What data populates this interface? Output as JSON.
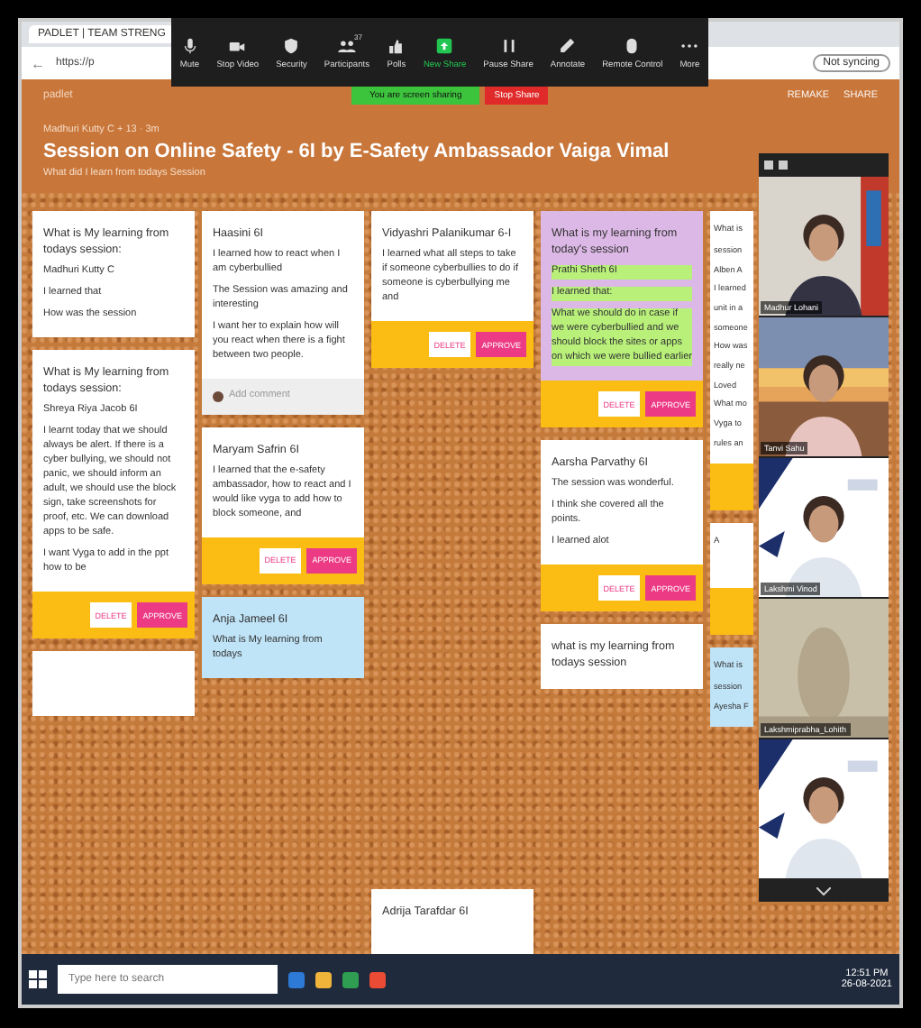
{
  "browser": {
    "tab_title": "PADLET | TEAM STRENG",
    "back": "←",
    "address": "https://p",
    "profile": "Not syncing"
  },
  "zoom_toolbar": {
    "buttons": [
      {
        "kind": "mic",
        "label": "Mute"
      },
      {
        "kind": "camera",
        "label": "Stop Video"
      },
      {
        "kind": "shield",
        "label": "Security"
      },
      {
        "kind": "people",
        "label": "Participants",
        "badge": "37"
      },
      {
        "kind": "polls",
        "label": "Polls"
      },
      {
        "kind": "share",
        "label": "New Share"
      },
      {
        "kind": "pause",
        "label": "Pause Share"
      },
      {
        "kind": "pen",
        "label": "Annotate"
      },
      {
        "kind": "mouse",
        "label": "Remote Control"
      },
      {
        "kind": "more",
        "label": "More"
      }
    ]
  },
  "share_banner": {
    "status": "You are screen sharing",
    "stop": "Stop Share"
  },
  "padlet": {
    "logo": "padlet",
    "actions": [
      "REMAKE",
      "SHARE"
    ],
    "author": "Madhuri Kutty C + 13 · 3m",
    "title": "Session on Online Safety - 6I by E-Safety Ambassador Vaiga Vimal",
    "subtitle": "What did I learn from todays Session",
    "columns": [
      {
        "cards": [
          {
            "color": "#ffffff",
            "title": "What is My learning from todays session:",
            "lines": [
              "Madhuri Kutty C",
              "I learned that",
              "How was the session"
            ]
          },
          {
            "color": "#ffffff",
            "title": "What is My learning from todays session:",
            "lines": [
              "Shreya Riya Jacob 6I",
              "I learnt today that we should always be alert. If there is a cyber bullying, we should not panic, we should inform an adult, we should use the block sign, take screenshots for proof, etc. We can download apps to be safe.",
              "I want Vyga to add in the ppt how to be"
            ],
            "moderation": {
              "delete": "DELETE",
              "approve": "APPROVE"
            }
          },
          {
            "color": "#ffffff"
          }
        ]
      },
      {
        "cards": [
          {
            "color": "#ffffff",
            "title": "Haasini 6I",
            "lines": [
              "I learned how to react when I am cyberbullied",
              "The Session was amazing and interesting",
              "I want her to explain how will you react when there is a fight between two people."
            ],
            "comment": "Add comment"
          },
          {
            "color": "#ffffff",
            "title": "Maryam Safrin 6I",
            "lines": [
              "I learned that the e-safety ambassador, how to react and I would like vyga to add how to block someone, and"
            ],
            "moderation": {
              "delete": "DELETE",
              "approve": "APPROVE"
            }
          },
          {
            "color": "#bfe3f7",
            "title": "Anja Jameel 6I",
            "lines": [
              "What is My learning from todays"
            ]
          }
        ]
      },
      {
        "cards": [
          {
            "color": "#ffffff",
            "title": "Vidyashri Palanikumar 6-I",
            "lines": [
              "I learned what all steps to take if someone cyberbullies to do if someone is cyberbullying me and"
            ],
            "moderation": {
              "delete": "DELETE",
              "approve": "APPROVE"
            }
          },
          {
            "color": "#ffffff",
            "title": "Adrija Tarafdar 6I"
          }
        ]
      },
      {
        "cards": [
          {
            "color": "#dcb8e6",
            "title": "What is my learning from today's session",
            "lines": [
              "Prathi Sheth 6I",
              "I learned that:",
              "What we should do in case if we were cyberbullied and we should block the sites or apps on which we were bullied earlier"
            ],
            "highlighted": true,
            "moderation": {
              "delete": "DELETE",
              "approve": "APPROVE"
            }
          },
          {
            "color": "#ffffff",
            "title": "Aarsha Parvathy 6I",
            "lines": [
              "The session was wonderful.",
              "I think she covered all the points.",
              "I learned alot"
            ],
            "moderation": {
              "delete": "DELETE",
              "approve": "APPROVE"
            }
          },
          {
            "color": "#ffffff",
            "title": "what is my learning from todays session"
          }
        ]
      },
      {
        "cards": [
          {
            "color": "#ffffff",
            "title": "What is",
            "lines": [
              "session",
              "Alben A",
              "I learned",
              "unit in a",
              "someone",
              "How was",
              "really ne",
              "Loved",
              "What mo",
              "Vyga to",
              "rules an"
            ],
            "pending": true
          },
          {
            "color": "#ffffff",
            "title": "A",
            "pending": true
          },
          {
            "color": "#bfe3f7",
            "title": "What is",
            "lines": [
              "session",
              "Ayesha F"
            ]
          }
        ]
      }
    ]
  },
  "video_panel": {
    "tiles": [
      {
        "kind": "picture",
        "name": "Madhur Lohani"
      },
      {
        "kind": "picture",
        "name": "Tanvi Sahu"
      },
      {
        "kind": "picture",
        "name": "Lakshmi Vinod"
      },
      {
        "kind": "picture",
        "name": "Lakshmiprabha_Lohith"
      },
      {
        "kind": "picture"
      }
    ]
  },
  "taskbar": {
    "search_placeholder": "Type here to search",
    "time": "12:51 PM",
    "date": "26-08-2021"
  }
}
